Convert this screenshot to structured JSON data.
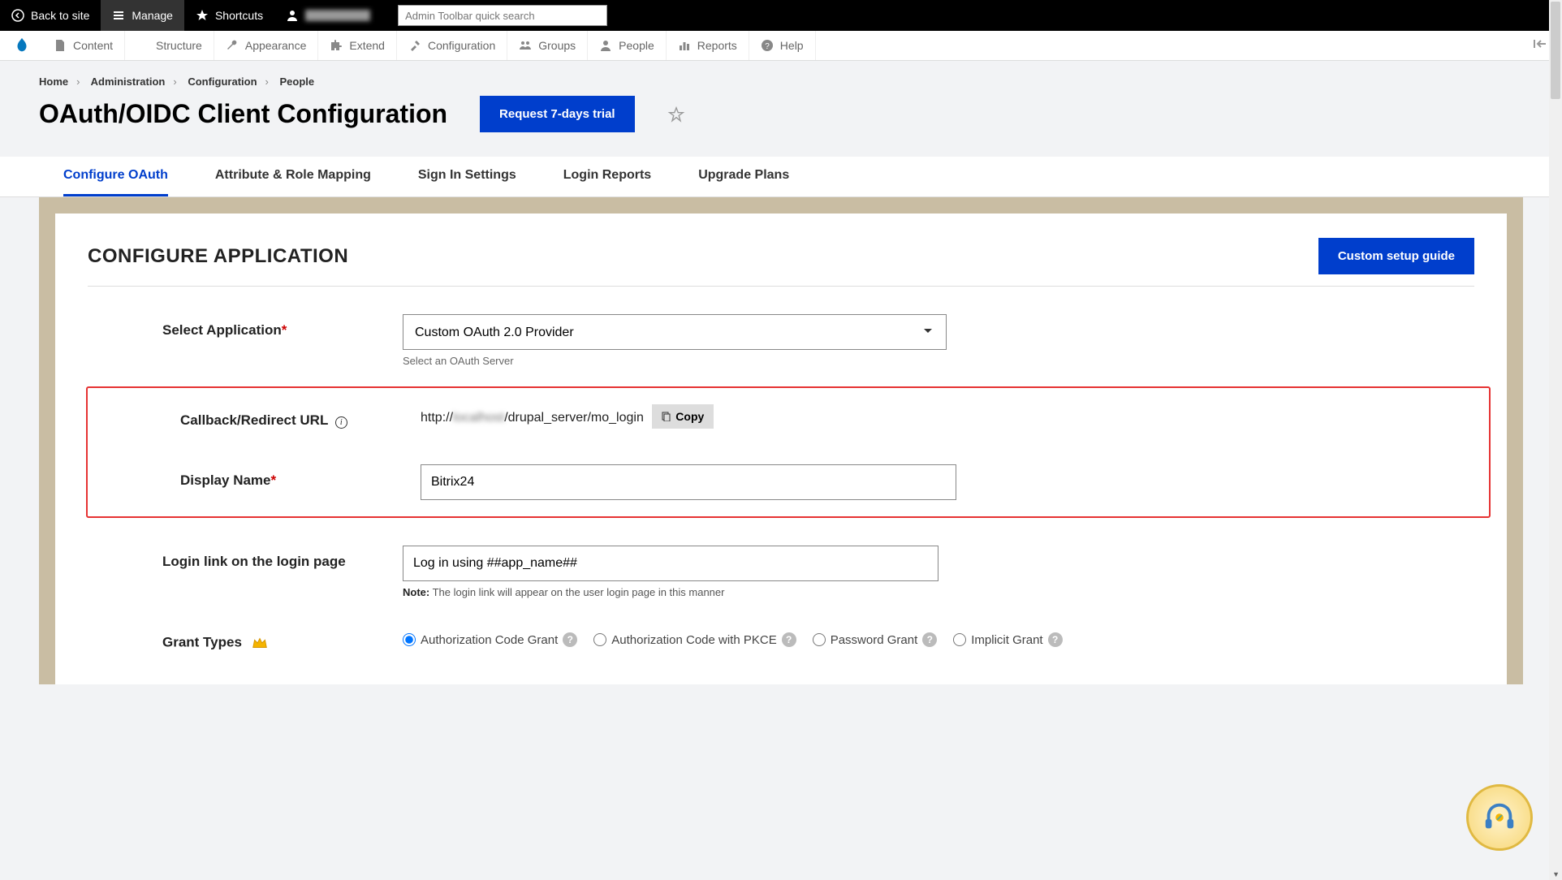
{
  "topbar": {
    "back_label": "Back to site",
    "manage_label": "Manage",
    "shortcuts_label": "Shortcuts",
    "search_placeholder": "Admin Toolbar quick search"
  },
  "adminmenu": {
    "items": [
      {
        "label": "Content"
      },
      {
        "label": "Structure"
      },
      {
        "label": "Appearance"
      },
      {
        "label": "Extend"
      },
      {
        "label": "Configuration"
      },
      {
        "label": "Groups"
      },
      {
        "label": "People"
      },
      {
        "label": "Reports"
      },
      {
        "label": "Help"
      }
    ]
  },
  "breadcrumb": {
    "items": [
      "Home",
      "Administration",
      "Configuration",
      "People"
    ]
  },
  "page": {
    "title": "OAuth/OIDC Client Configuration",
    "trial_button": "Request 7-days trial"
  },
  "tabs": {
    "items": [
      {
        "label": "Configure OAuth",
        "active": true
      },
      {
        "label": "Attribute & Role Mapping"
      },
      {
        "label": "Sign In Settings"
      },
      {
        "label": "Login Reports"
      },
      {
        "label": "Upgrade Plans"
      }
    ]
  },
  "panel": {
    "heading": "CONFIGURE APPLICATION",
    "setup_guide_btn": "Custom setup guide"
  },
  "form": {
    "select_app_label": "Select Application",
    "select_app_value": "Custom OAuth 2.0 Provider",
    "select_app_helper": "Select an OAuth Server",
    "callback_label": "Callback/Redirect URL",
    "callback_prefix": "http://",
    "callback_blur": "localhost",
    "callback_suffix": "/drupal_server/mo_login",
    "copy_label": "Copy",
    "display_name_label": "Display Name",
    "display_name_value": "Bitrix24",
    "login_link_label": "Login link on the login page",
    "login_link_value": "Log in using ##app_name##",
    "login_link_note_b": "Note:",
    "login_link_note": " The login link will appear on the user login page in this manner",
    "grant_types_label": "Grant Types",
    "grants": [
      {
        "label": "Authorization Code Grant",
        "checked": true
      },
      {
        "label": "Authorization Code with PKCE",
        "checked": false
      },
      {
        "label": "Password Grant",
        "checked": false
      },
      {
        "label": "Implicit Grant",
        "checked": false
      }
    ]
  }
}
